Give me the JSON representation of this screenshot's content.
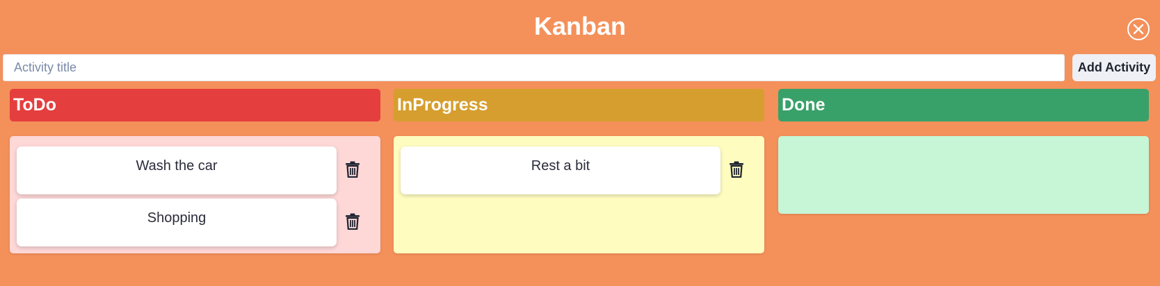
{
  "app": {
    "title": "Kanban"
  },
  "add_form": {
    "placeholder": "Activity title",
    "value": "",
    "button_label": "Add Activity"
  },
  "columns": [
    {
      "title": "ToDo",
      "header_color": "#e53e3e",
      "body_color": "#fed7d7",
      "cards": [
        {
          "text": "Wash the car"
        },
        {
          "text": "Shopping"
        }
      ]
    },
    {
      "title": "InProgress",
      "header_color": "#d69e2e",
      "body_color": "#fefcbf",
      "cards": [
        {
          "text": "Rest a bit"
        }
      ]
    },
    {
      "title": "Done",
      "header_color": "#38a169",
      "body_color": "#c6f6d5",
      "cards": []
    }
  ],
  "icons": {
    "close": "close-circle-icon",
    "delete": "trash-icon"
  }
}
